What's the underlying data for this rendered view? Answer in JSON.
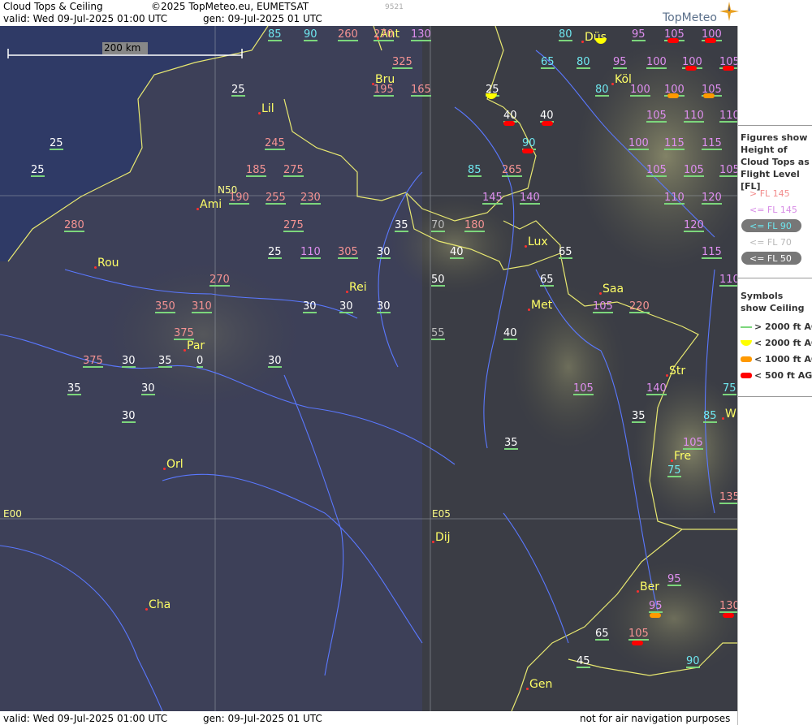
{
  "header": {
    "title": "Cloud Tops & Ceiling",
    "copyright": "©2025 TopMeteo.eu, EUMETSAT",
    "valid": "valid:  Wed  09-Jul-2025  01:00 UTC",
    "gen": "gen: 09-Jul-2025 01 UTC",
    "code": "9521",
    "brand": "TopMeteo"
  },
  "footer": {
    "valid": "valid:  Wed  09-Jul-2025  01:00 UTC",
    "gen": "gen: 09-Jul-2025 01 UTC",
    "disclaimer": "not for air navigation purposes"
  },
  "scale": {
    "label": "200 km"
  },
  "grid_labels": {
    "n50": "N50",
    "e00": "E00",
    "e05": "E05"
  },
  "legend": {
    "figures_title": "Figures show Height of Cloud Tops as Flight Level [FL]",
    "fl_items": [
      {
        "label": "> FL 145",
        "color": "#f28c8c"
      },
      {
        "label": "<= FL 145",
        "color": "#d78be6"
      },
      {
        "label": "<= FL 90",
        "color": "#6ee6ee"
      },
      {
        "label": "<= FL 70",
        "color": "#b8b8b8"
      },
      {
        "label": "<= FL 50",
        "color": "#ffffff"
      }
    ],
    "symbols_title": "Symbols show Ceiling",
    "ceiling_items": [
      {
        "label": "> 2000 ft AGL",
        "color": "#7cd67c"
      },
      {
        "label": "< 2000 ft AGL",
        "color": "#ffff00"
      },
      {
        "label": "< 1000 ft AGL",
        "color": "#ff9900"
      },
      {
        "label": "< 500 ft AGL",
        "color": "#ff0000"
      }
    ]
  },
  "colors": {
    "high": "#f59393",
    "mid": "#df8ff0",
    "low": "#6fe7ef",
    "lower": "#bcbcbc",
    "lowest": "#ffffff",
    "city": "#ffff66",
    "river": "#5a78ff",
    "border": "#e8e870",
    "sea": "#2f3b63"
  },
  "cities": [
    "Düs",
    "Köl",
    "Bru",
    "Ant",
    "Lil",
    "Ami",
    "Rou",
    "Rei",
    "Lux",
    "Saa",
    "Met",
    "Par",
    "Str",
    "Fre",
    "Orl",
    "Dij",
    "Cha",
    "Ber",
    "Gen",
    "W"
  ],
  "labels": [
    {
      "v": "85",
      "c": "low"
    },
    {
      "v": "90",
      "c": "low"
    },
    {
      "v": "260",
      "c": "high"
    },
    {
      "v": "270",
      "c": "high"
    },
    {
      "v": "130",
      "c": "mid"
    },
    {
      "v": "80",
      "c": "low"
    },
    {
      "v": "95",
      "c": "mid"
    },
    {
      "v": "105",
      "c": "mid"
    },
    {
      "v": "100",
      "c": "mid"
    },
    {
      "v": "325",
      "c": "high"
    },
    {
      "v": "65",
      "c": "low"
    },
    {
      "v": "80",
      "c": "low"
    },
    {
      "v": "95",
      "c": "mid"
    },
    {
      "v": "100",
      "c": "mid"
    },
    {
      "v": "100",
      "c": "mid"
    },
    {
      "v": "105",
      "c": "mid"
    },
    {
      "v": "25",
      "c": "lowest"
    },
    {
      "v": "195",
      "c": "high"
    },
    {
      "v": "165",
      "c": "high"
    },
    {
      "v": "25",
      "c": "lowest"
    },
    {
      "v": "80",
      "c": "low"
    },
    {
      "v": "100",
      "c": "mid"
    },
    {
      "v": "100",
      "c": "mid"
    },
    {
      "v": "105",
      "c": "mid"
    },
    {
      "v": "40",
      "c": "lowest"
    },
    {
      "v": "40",
      "c": "lowest"
    },
    {
      "v": "105",
      "c": "mid"
    },
    {
      "v": "110",
      "c": "mid"
    },
    {
      "v": "110",
      "c": "mid"
    },
    {
      "v": "25",
      "c": "lowest"
    },
    {
      "v": "245",
      "c": "high"
    },
    {
      "v": "90",
      "c": "low"
    },
    {
      "v": "100",
      "c": "mid"
    },
    {
      "v": "115",
      "c": "mid"
    },
    {
      "v": "115",
      "c": "mid"
    },
    {
      "v": "25",
      "c": "lowest"
    },
    {
      "v": "185",
      "c": "high"
    },
    {
      "v": "275",
      "c": "high"
    },
    {
      "v": "85",
      "c": "low"
    },
    {
      "v": "265",
      "c": "high"
    },
    {
      "v": "105",
      "c": "mid"
    },
    {
      "v": "105",
      "c": "mid"
    },
    {
      "v": "105",
      "c": "mid"
    },
    {
      "v": "190",
      "c": "high"
    },
    {
      "v": "255",
      "c": "high"
    },
    {
      "v": "230",
      "c": "high"
    },
    {
      "v": "145",
      "c": "mid"
    },
    {
      "v": "140",
      "c": "mid"
    },
    {
      "v": "110",
      "c": "mid"
    },
    {
      "v": "120",
      "c": "mid"
    },
    {
      "v": "280",
      "c": "high"
    },
    {
      "v": "275",
      "c": "high"
    },
    {
      "v": "35",
      "c": "lowest"
    },
    {
      "v": "70",
      "c": "lower"
    },
    {
      "v": "180",
      "c": "high"
    },
    {
      "v": "120",
      "c": "mid"
    },
    {
      "v": "25",
      "c": "lowest"
    },
    {
      "v": "110",
      "c": "mid"
    },
    {
      "v": "305",
      "c": "high"
    },
    {
      "v": "30",
      "c": "lowest"
    },
    {
      "v": "40",
      "c": "lowest"
    },
    {
      "v": "65",
      "c": "lowest"
    },
    {
      "v": "115",
      "c": "mid"
    },
    {
      "v": "270",
      "c": "high"
    },
    {
      "v": "50",
      "c": "lowest"
    },
    {
      "v": "65",
      "c": "lowest"
    },
    {
      "v": "110",
      "c": "mid"
    },
    {
      "v": "350",
      "c": "high"
    },
    {
      "v": "310",
      "c": "high"
    },
    {
      "v": "30",
      "c": "lowest"
    },
    {
      "v": "30",
      "c": "lowest"
    },
    {
      "v": "30",
      "c": "lowest"
    },
    {
      "v": "105",
      "c": "mid"
    },
    {
      "v": "220",
      "c": "high"
    },
    {
      "v": "375",
      "c": "high"
    },
    {
      "v": "55",
      "c": "lower"
    },
    {
      "v": "40",
      "c": "lowest"
    },
    {
      "v": "375",
      "c": "high"
    },
    {
      "v": "30",
      "c": "lowest"
    },
    {
      "v": "35",
      "c": "lowest"
    },
    {
      "v": "0",
      "c": "lowest"
    },
    {
      "v": "30",
      "c": "lowest"
    },
    {
      "v": "35",
      "c": "lowest"
    },
    {
      "v": "30",
      "c": "lowest"
    },
    {
      "v": "105",
      "c": "mid"
    },
    {
      "v": "140",
      "c": "mid"
    },
    {
      "v": "75",
      "c": "low"
    },
    {
      "v": "30",
      "c": "lowest"
    },
    {
      "v": "35",
      "c": "lowest"
    },
    {
      "v": "85",
      "c": "low"
    },
    {
      "v": "35",
      "c": "lowest"
    },
    {
      "v": "105",
      "c": "mid"
    },
    {
      "v": "75",
      "c": "low"
    },
    {
      "v": "135",
      "c": "high"
    },
    {
      "v": "95",
      "c": "mid"
    },
    {
      "v": "95",
      "c": "mid"
    },
    {
      "v": "130",
      "c": "high"
    },
    {
      "v": "65",
      "c": "lowest"
    },
    {
      "v": "105",
      "c": "high"
    },
    {
      "v": "45",
      "c": "lowest"
    },
    {
      "v": "90",
      "c": "low"
    }
  ],
  "ceiling_symbols": [
    "yellow",
    "red",
    "red",
    "red",
    "red",
    "yellow",
    "orange",
    "orange",
    "red",
    "red",
    "red",
    "orange",
    "red",
    "red",
    "red"
  ]
}
